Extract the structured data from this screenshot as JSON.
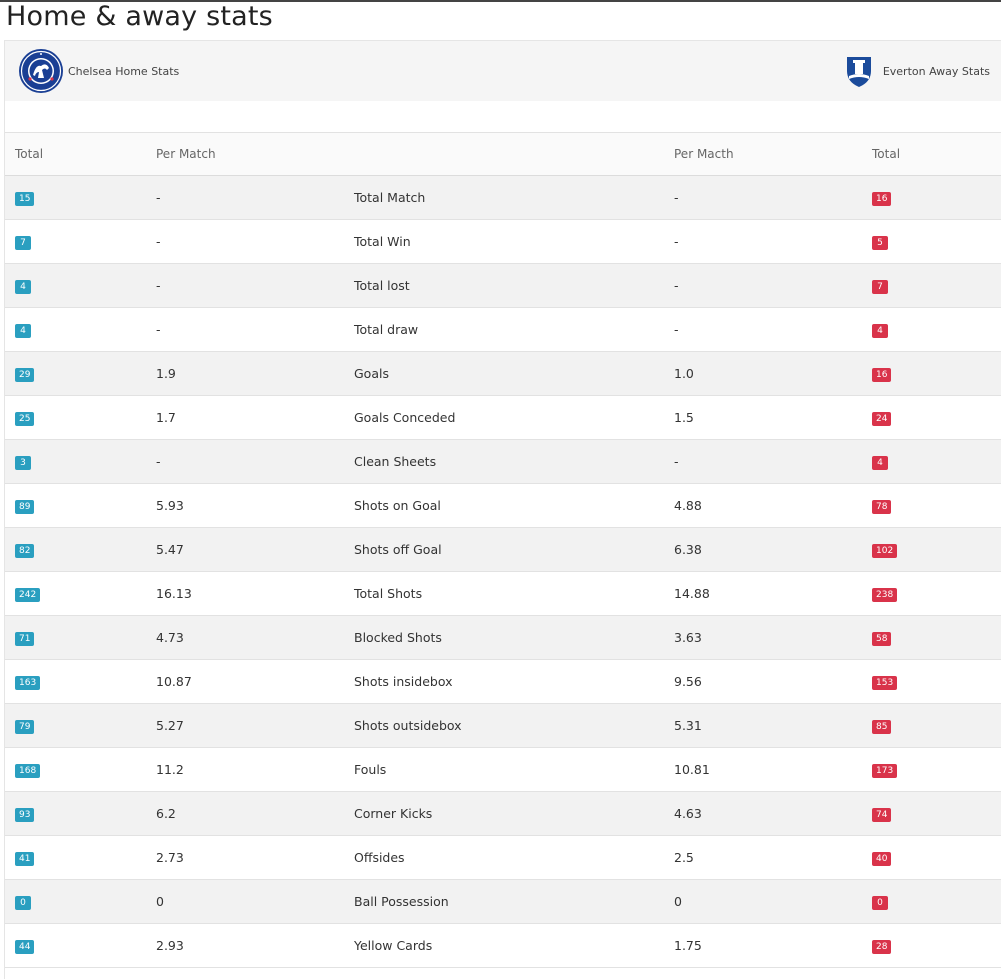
{
  "page": {
    "title": "Home & away stats"
  },
  "teams": {
    "home": {
      "name": "Chelsea Home Stats",
      "crest_icon": "chelsea-crest-icon",
      "color": "#1a3f94"
    },
    "away": {
      "name": "Everton Away Stats",
      "crest_icon": "everton-crest-icon",
      "color": "#1b4b9b"
    }
  },
  "colors": {
    "home_badge": "#2a9fc0",
    "away_badge": "#d9334a"
  },
  "table": {
    "headers": {
      "home_total": "Total",
      "home_per_match": "Per Match",
      "stat": "",
      "away_per_match": "Per Macth",
      "away_total": "Total"
    },
    "rows": [
      {
        "home_total": "15",
        "home_per_match": "-",
        "stat": "Total Match",
        "away_per_match": "-",
        "away_total": "16"
      },
      {
        "home_total": "7",
        "home_per_match": "-",
        "stat": "Total Win",
        "away_per_match": "-",
        "away_total": "5"
      },
      {
        "home_total": "4",
        "home_per_match": "-",
        "stat": "Total lost",
        "away_per_match": "-",
        "away_total": "7"
      },
      {
        "home_total": "4",
        "home_per_match": "-",
        "stat": "Total draw",
        "away_per_match": "-",
        "away_total": "4"
      },
      {
        "home_total": "29",
        "home_per_match": "1.9",
        "stat": "Goals",
        "away_per_match": "1.0",
        "away_total": "16"
      },
      {
        "home_total": "25",
        "home_per_match": "1.7",
        "stat": "Goals Conceded",
        "away_per_match": "1.5",
        "away_total": "24"
      },
      {
        "home_total": "3",
        "home_per_match": "-",
        "stat": "Clean Sheets",
        "away_per_match": "-",
        "away_total": "4"
      },
      {
        "home_total": "89",
        "home_per_match": "5.93",
        "stat": "Shots on Goal",
        "away_per_match": "4.88",
        "away_total": "78"
      },
      {
        "home_total": "82",
        "home_per_match": "5.47",
        "stat": "Shots off Goal",
        "away_per_match": "6.38",
        "away_total": "102"
      },
      {
        "home_total": "242",
        "home_per_match": "16.13",
        "stat": "Total Shots",
        "away_per_match": "14.88",
        "away_total": "238"
      },
      {
        "home_total": "71",
        "home_per_match": "4.73",
        "stat": "Blocked Shots",
        "away_per_match": "3.63",
        "away_total": "58"
      },
      {
        "home_total": "163",
        "home_per_match": "10.87",
        "stat": "Shots insidebox",
        "away_per_match": "9.56",
        "away_total": "153"
      },
      {
        "home_total": "79",
        "home_per_match": "5.27",
        "stat": "Shots outsidebox",
        "away_per_match": "5.31",
        "away_total": "85"
      },
      {
        "home_total": "168",
        "home_per_match": "11.2",
        "stat": "Fouls",
        "away_per_match": "10.81",
        "away_total": "173"
      },
      {
        "home_total": "93",
        "home_per_match": "6.2",
        "stat": "Corner Kicks",
        "away_per_match": "4.63",
        "away_total": "74"
      },
      {
        "home_total": "41",
        "home_per_match": "2.73",
        "stat": "Offsides",
        "away_per_match": "2.5",
        "away_total": "40"
      },
      {
        "home_total": "0",
        "home_per_match": "0",
        "stat": "Ball Possession",
        "away_per_match": "0",
        "away_total": "0"
      },
      {
        "home_total": "44",
        "home_per_match": "2.93",
        "stat": "Yellow Cards",
        "away_per_match": "1.75",
        "away_total": "28"
      }
    ]
  }
}
